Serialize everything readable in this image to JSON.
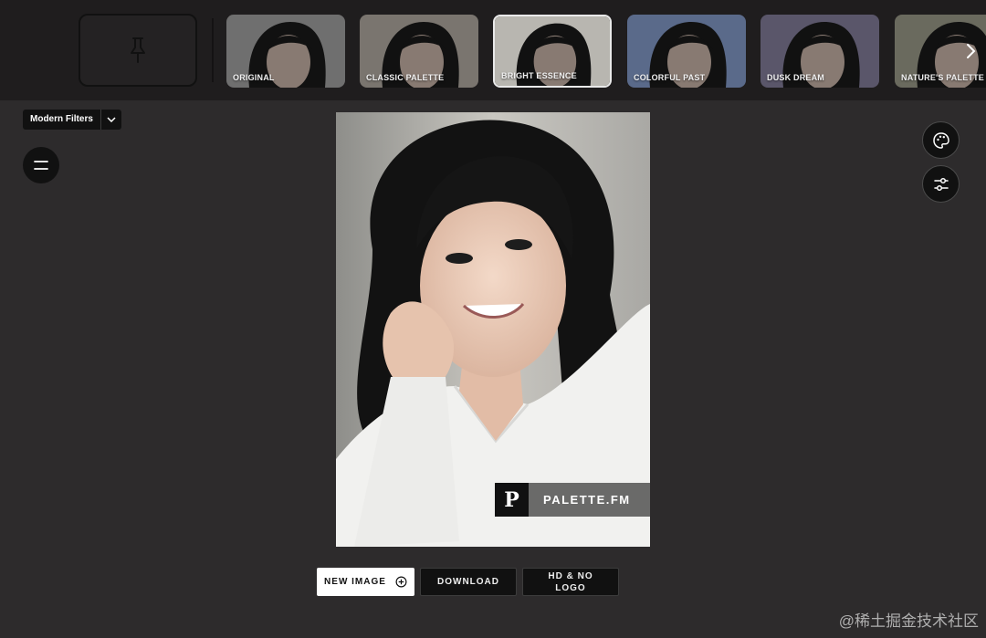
{
  "filters": [
    {
      "label": "ORIGINAL",
      "tint": "#6f6f6f"
    },
    {
      "label": "CLASSIC PALETTE",
      "tint": "#7a756f"
    },
    {
      "label": "BRIGHT ESSENCE",
      "tint": "#b8b6b0",
      "selected": true
    },
    {
      "label": "COLORFUL PAST",
      "tint": "#5a6a8a"
    },
    {
      "label": "DUSK DREAM",
      "tint": "#5a566a"
    },
    {
      "label": "NATURE'S PALETTE",
      "tint": "#6a6a5e"
    }
  ],
  "toolbar": {
    "filter_dropdown": "Modern Filters"
  },
  "image": {
    "watermark_logo": "P",
    "watermark_text": "PALETTE.FM"
  },
  "actions": {
    "new_image": "NEW IMAGE",
    "download": "DOWNLOAD",
    "hd_no_logo": "HD & NO LOGO"
  },
  "footer": {
    "source_mark": "@稀土掘金技术社区"
  },
  "icons": {
    "pin": "pin-icon",
    "next": "chevron-right-icon",
    "dropdown": "chevron-down-icon",
    "menu": "menu-icon",
    "palette": "palette-icon",
    "adjust": "sliders-icon",
    "add": "plus-circle-icon"
  }
}
